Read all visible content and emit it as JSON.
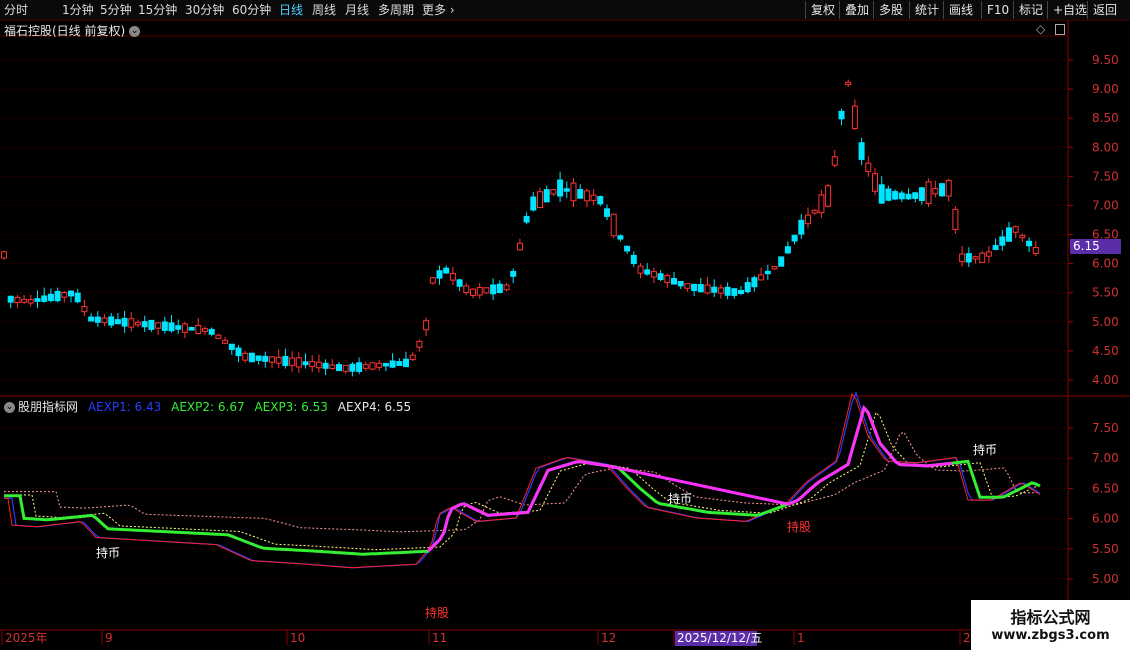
{
  "toolbar": {
    "periods": [
      "分时",
      "1分钟",
      "5分钟",
      "15分钟",
      "30分钟",
      "60分钟",
      "日线",
      "周线",
      "月线",
      "多周期",
      "更多"
    ],
    "active_period": "日线",
    "tools": [
      "复权",
      "叠加",
      "多股",
      "统计",
      "画线",
      "F10",
      "标记",
      "+自选",
      "返回"
    ]
  },
  "main_panel": {
    "title": "福石控股(日线 前复权)",
    "y_ticks": [
      "9.50",
      "9.00",
      "8.50",
      "8.00",
      "7.50",
      "7.00",
      "6.50",
      "6.00",
      "5.50",
      "5.00",
      "4.50",
      "4.00"
    ],
    "current_price": "6.15"
  },
  "indicator_panel": {
    "name": "股朋指标网",
    "legend": [
      {
        "label": "AEXP1: 6.43",
        "color": "#2a3bff"
      },
      {
        "label": "AEXP2: 6.67",
        "color": "#33ee33"
      },
      {
        "label": "AEXP3: 6.53",
        "color": "#33ee33"
      },
      {
        "label": "AEXP4: 6.55",
        "color": "#e8e8e8"
      }
    ],
    "y_ticks": [
      "7.50",
      "7.00",
      "6.50",
      "6.00",
      "5.50",
      "5.00"
    ],
    "annotations": [
      "持币",
      "持股",
      "持币",
      "持股",
      "持币"
    ]
  },
  "time_axis": {
    "labels": [
      "2025年",
      "9",
      "10",
      "11",
      "12",
      "2025/12/12/五",
      "1",
      "2"
    ]
  },
  "watermark": {
    "line1": "指标公式网",
    "line2": "www.zbgs3.com"
  },
  "colors": {
    "up": "#ff3232",
    "down": "#00e5ff",
    "grid": "#5a0000",
    "magenta": "#ff30ff",
    "green": "#33ee33",
    "blue": "#2a3bff"
  }
}
